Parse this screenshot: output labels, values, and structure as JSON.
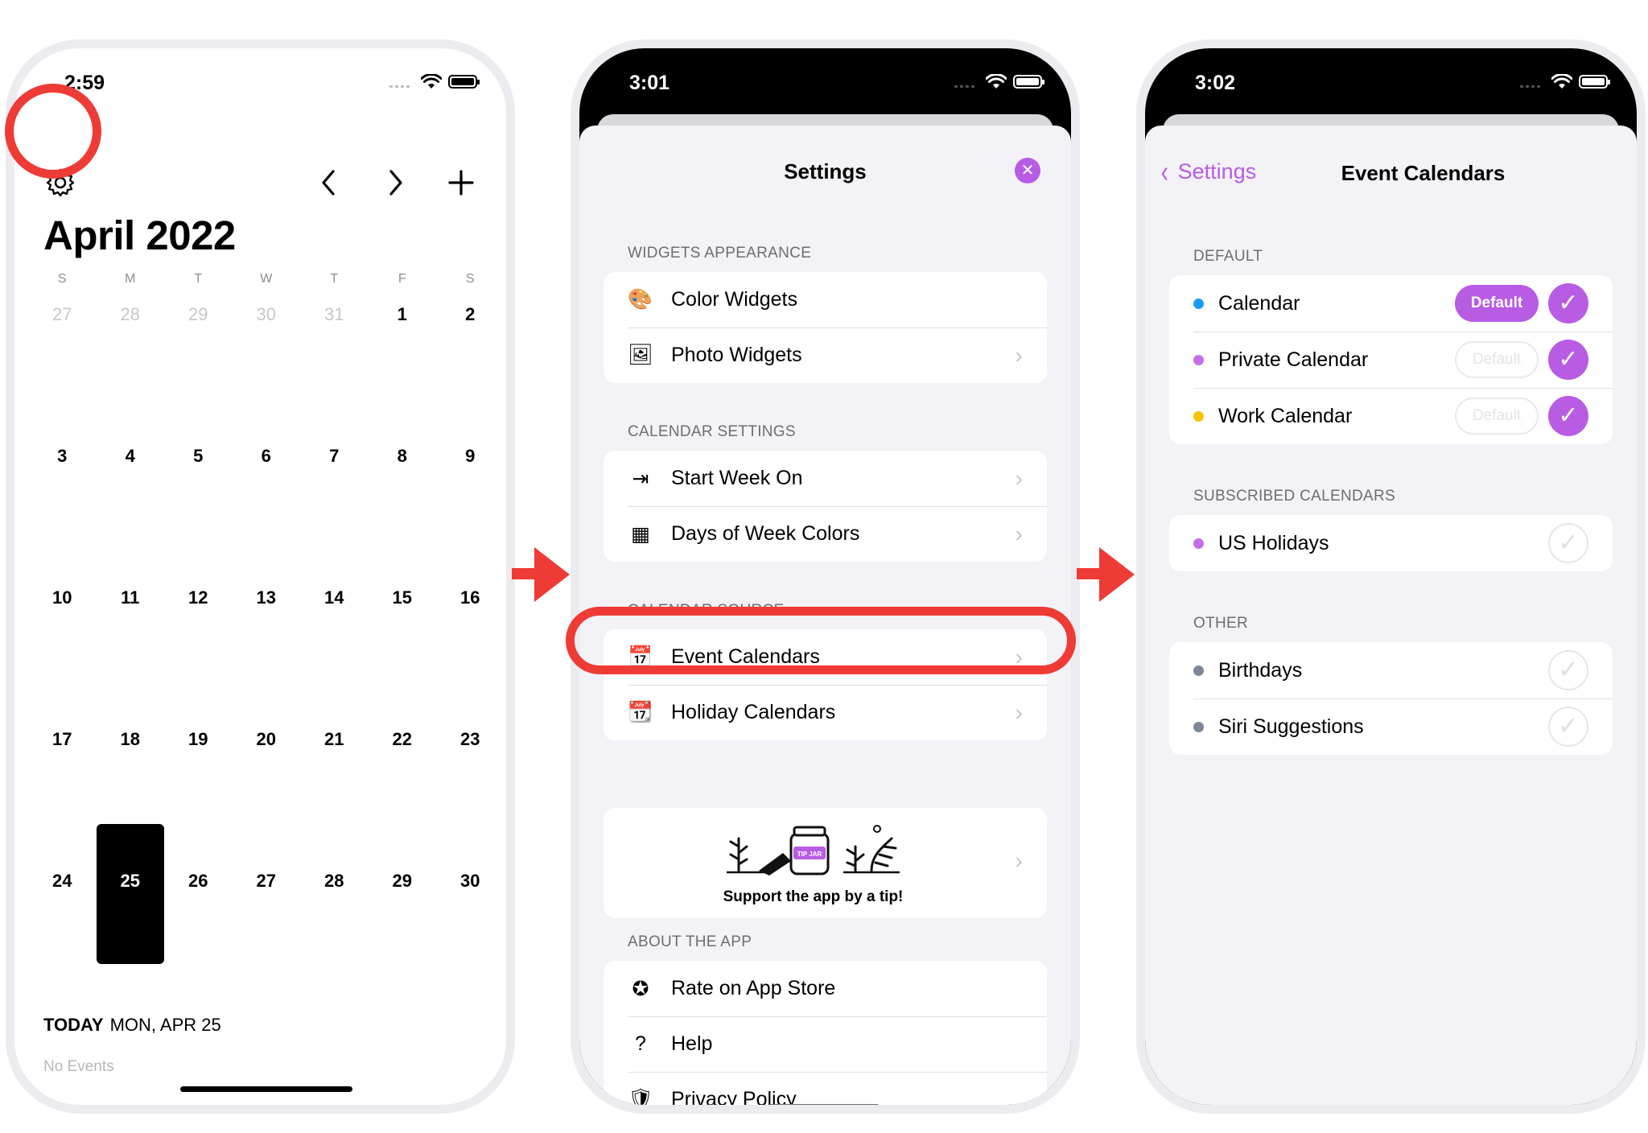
{
  "colors": {
    "accent": "#b85ce4",
    "highlight_red": "#ef3b36",
    "calendar_blue": "#1a9cf5",
    "work_yellow": "#f5c400",
    "other_gray": "#7d8797"
  },
  "phone1": {
    "time": "2:59",
    "icons": {
      "settings": "gear-icon",
      "prev": "chevron-left-icon",
      "next": "chevron-right-icon",
      "add": "plus-icon"
    },
    "icon_glyphs": {
      "settings": "⚙",
      "prev": "‹",
      "next": "›",
      "add": "+"
    },
    "month_title": "April 2022",
    "weekdays": [
      "S",
      "M",
      "T",
      "W",
      "T",
      "F",
      "S"
    ],
    "weeks": [
      [
        "27",
        "28",
        "29",
        "30",
        "31",
        "1",
        "2"
      ],
      [
        "3",
        "4",
        "5",
        "6",
        "7",
        "8",
        "9"
      ],
      [
        "10",
        "11",
        "12",
        "13",
        "14",
        "15",
        "16"
      ],
      [
        "17",
        "18",
        "19",
        "20",
        "21",
        "22",
        "23"
      ],
      [
        "24",
        "25",
        "26",
        "27",
        "28",
        "29",
        "30"
      ]
    ],
    "today_label": "TODAY",
    "today_date": "MON, APR 25",
    "no_events": "No Events"
  },
  "phone2": {
    "time": "3:01",
    "title": "Settings",
    "close_glyph": "✕",
    "sections": {
      "widgets": {
        "header": "WIDGETS APPEARANCE",
        "items": [
          {
            "label": "Color Widgets",
            "icon": "palette-icon",
            "glyph": "🎨"
          },
          {
            "label": "Photo Widgets",
            "icon": "photo-icon",
            "glyph": "🖼"
          }
        ]
      },
      "calendar_settings": {
        "header": "CALENDAR SETTINGS",
        "items": [
          {
            "label": "Start Week On",
            "icon": "arrow-box-icon",
            "glyph": "⇥"
          },
          {
            "label": "Days of Week Colors",
            "icon": "calendar-grid-icon",
            "glyph": "▦"
          }
        ]
      },
      "calendar_source": {
        "header": "CALENDAR SOURCE",
        "items": [
          {
            "label": "Event Calendars",
            "icon": "calendar-clock-icon",
            "glyph": "📅"
          },
          {
            "label": "Holiday Calendars",
            "icon": "calendar-plus-icon",
            "glyph": "📆"
          }
        ]
      },
      "tip": {
        "text": "Support the app by a tip!",
        "jar_label": "TIP JAR"
      },
      "about": {
        "header": "ABOUT THE APP",
        "items": [
          {
            "label": "Rate on App Store",
            "icon": "star-circle-icon",
            "glyph": "✪"
          },
          {
            "label": "Help",
            "icon": "question-circle-icon",
            "glyph": "?"
          },
          {
            "label": "Privacy Policy",
            "icon": "shield-check-icon",
            "glyph": "🛡"
          }
        ]
      }
    }
  },
  "phone3": {
    "time": "3:02",
    "back_label": "Settings",
    "title": "Event Calendars",
    "pill_label": "Default",
    "check_glyph": "✓",
    "sections": {
      "default": {
        "header": "DEFAULT",
        "items": [
          {
            "label": "Calendar",
            "color": "#1a9cf5",
            "is_default": true,
            "checked": true
          },
          {
            "label": "Private Calendar",
            "color": "#c46ee6",
            "is_default": false,
            "checked": true
          },
          {
            "label": "Work Calendar",
            "color": "#f5c400",
            "is_default": false,
            "checked": true
          }
        ]
      },
      "subscribed": {
        "header": "SUBSCRIBED CALENDARS",
        "items": [
          {
            "label": "US Holidays",
            "color": "#c46ee6",
            "checked": false
          }
        ]
      },
      "other": {
        "header": "OTHER",
        "items": [
          {
            "label": "Birthdays",
            "color": "#7d8797",
            "checked": false
          },
          {
            "label": "Siri Suggestions",
            "color": "#7d8797",
            "checked": false
          }
        ]
      }
    }
  }
}
